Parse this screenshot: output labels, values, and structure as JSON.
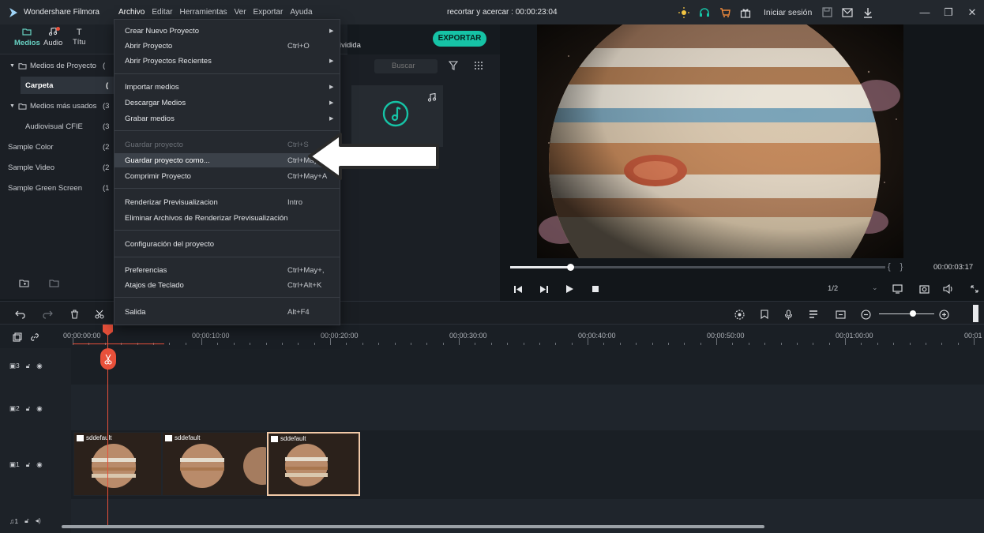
{
  "app": {
    "name": "Wondershare Filmora",
    "project_title": "recortar y acercar : 00:00:23:04",
    "signin": "Iniciar sesión"
  },
  "menubar": [
    "Archivo",
    "Editar",
    "Herramientas",
    "Ver",
    "Exportar",
    "Ayuda"
  ],
  "media_tabs": [
    {
      "label": "Medios",
      "icon": "folder-icon"
    },
    {
      "label": "Audio",
      "icon": "music-note-icon"
    },
    {
      "label": "Títu",
      "icon": "text-icon"
    }
  ],
  "export_label": "EXPORTAR",
  "partial_label": "ividida",
  "search": {
    "placeholder": "Buscar"
  },
  "sidebar": [
    {
      "label": "Medios de Proyecto",
      "count": "("
    },
    {
      "label": "Carpeta",
      "count": "("
    },
    {
      "label": "Medios más usados",
      "count": "(3"
    },
    {
      "label": "Audiovisual CFIE",
      "count": "(3"
    },
    {
      "label": "Sample Color",
      "count": "(2"
    },
    {
      "label": "Sample Video",
      "count": "(2"
    },
    {
      "label": "Sample Green Screen",
      "count": "(1"
    }
  ],
  "file_menu": [
    {
      "label": "Crear Nuevo Proyecto",
      "shortcut": "",
      "submenu": true
    },
    {
      "label": "Abrir Proyecto",
      "shortcut": "Ctrl+O"
    },
    {
      "label": "Abrir Proyectos Recientes",
      "shortcut": "",
      "submenu": true
    },
    {
      "label": "Importar medios",
      "shortcut": "",
      "submenu": true
    },
    {
      "label": "Descargar Medios",
      "shortcut": "",
      "submenu": true
    },
    {
      "label": "Grabar medios",
      "shortcut": "",
      "submenu": true
    },
    {
      "label": "Guardar proyecto",
      "shortcut": "Ctrl+S",
      "disabled": true
    },
    {
      "label": "Guardar proyecto como...",
      "shortcut": "Ctrl+May",
      "highlighted": true
    },
    {
      "label": "Comprimir Proyecto",
      "shortcut": "Ctrl+May+A"
    },
    {
      "label": "Renderizar Previsualizacion",
      "shortcut": "Intro"
    },
    {
      "label": "Eliminar Archivos de Renderizar Previsualización",
      "shortcut": ""
    },
    {
      "label": "Configuración del proyecto",
      "shortcut": ""
    },
    {
      "label": "Preferencias",
      "shortcut": "Ctrl+May+,"
    },
    {
      "label": "Atajos de Teclado",
      "shortcut": "Ctrl+Alt+K"
    },
    {
      "label": "Salida",
      "shortcut": "Alt+F4"
    }
  ],
  "preview": {
    "timecode": "00:00:03:17",
    "ratio": "1/2",
    "progress": 0.16
  },
  "ruler": [
    "00:00:00:00",
    "00:00:10:00",
    "00:00:20:00",
    "00:00:30:00",
    "00:00:40:00",
    "00:00:50:00",
    "00:01:00:00",
    "00:01"
  ],
  "tracks": {
    "v3": "3",
    "v2": "2",
    "v1": "1",
    "a1": "1"
  },
  "clips": [
    {
      "label": "sddefault"
    },
    {
      "label": "sddefault"
    },
    {
      "label": "sddefault"
    }
  ],
  "colors": {
    "accent": "#16c3a6",
    "playhead": "#e8503a",
    "selected_clip": "#f1c9a7"
  }
}
